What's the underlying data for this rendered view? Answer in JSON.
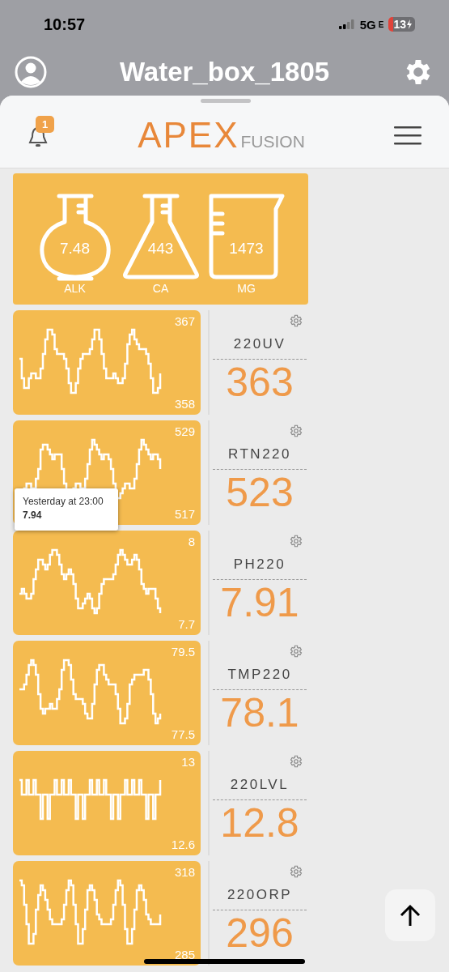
{
  "status_bar": {
    "time": "10:57",
    "network": "5G",
    "network_suffix": "E",
    "battery": "13"
  },
  "header": {
    "title": "Water_box_1805"
  },
  "toolbar": {
    "notification_count": "1",
    "logo_main": "APEX",
    "logo_sub": "FUSION"
  },
  "probes": [
    {
      "kind": "round",
      "value": "7.48",
      "label": "ALK"
    },
    {
      "kind": "conical",
      "value": "443",
      "label": "CA"
    },
    {
      "kind": "beaker",
      "value": "1473",
      "label": "MG"
    }
  ],
  "tiles": [
    {
      "name": "220UV",
      "value": "363",
      "max": "367",
      "min": "358"
    },
    {
      "name": "RTN220",
      "value": "523",
      "max": "529",
      "min": "517",
      "tooltip": {
        "title": "Yesterday at 23:00",
        "value": "7.94"
      }
    },
    {
      "name": "PH220",
      "value": "7.91",
      "max": "8",
      "min": "7.7"
    },
    {
      "name": "TMP220",
      "value": "78.1",
      "max": "79.5",
      "min": "77.5"
    },
    {
      "name": "220LVL",
      "value": "12.8",
      "max": "13",
      "min": "12.6"
    },
    {
      "name": "220ORP",
      "value": "296",
      "max": "318",
      "min": "285"
    }
  ]
}
